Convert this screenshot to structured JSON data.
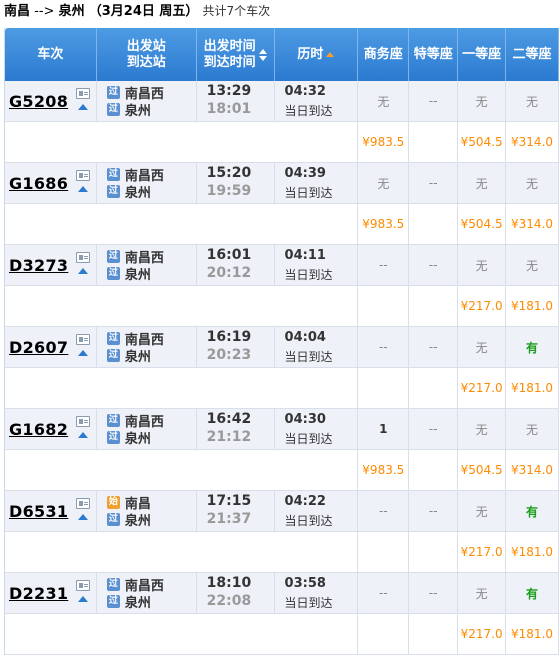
{
  "route": {
    "from": "南昌",
    "arrow": "-->",
    "to": "泉州",
    "date": "（3月24日  周五）",
    "count": "共计7个车次"
  },
  "headers": {
    "train_no": "车次",
    "station_top": "出发站",
    "station_bottom": "到达站",
    "time_top": "出发时间",
    "time_bottom": "到达时间",
    "duration": "历时",
    "business": "商务座",
    "special": "特等座",
    "first": "一等座",
    "second": "二等座"
  },
  "trains": [
    {
      "no": "G5208",
      "from": "南昌西",
      "from_type": "过",
      "to": "泉州",
      "to_type": "过",
      "dep": "13:29",
      "arr": "18:01",
      "dur": "04:32",
      "note": "当日到达",
      "seats": [
        "无",
        "--",
        "无",
        "无"
      ],
      "prices": [
        "¥983.5",
        "",
        "¥504.5",
        "¥314.0"
      ]
    },
    {
      "no": "G1686",
      "from": "南昌西",
      "from_type": "过",
      "to": "泉州",
      "to_type": "过",
      "dep": "15:20",
      "arr": "19:59",
      "dur": "04:39",
      "note": "当日到达",
      "seats": [
        "无",
        "--",
        "无",
        "无"
      ],
      "prices": [
        "¥983.5",
        "",
        "¥504.5",
        "¥314.0"
      ]
    },
    {
      "no": "D3273",
      "from": "南昌西",
      "from_type": "过",
      "to": "泉州",
      "to_type": "过",
      "dep": "16:01",
      "arr": "20:12",
      "dur": "04:11",
      "note": "当日到达",
      "seats": [
        "--",
        "--",
        "无",
        "无"
      ],
      "prices": [
        "",
        "",
        "¥217.0",
        "¥181.0"
      ]
    },
    {
      "no": "D2607",
      "from": "南昌西",
      "from_type": "过",
      "to": "泉州",
      "to_type": "过",
      "dep": "16:19",
      "arr": "20:23",
      "dur": "04:04",
      "note": "当日到达",
      "seats": [
        "--",
        "--",
        "无",
        "有"
      ],
      "prices": [
        "",
        "",
        "¥217.0",
        "¥181.0"
      ]
    },
    {
      "no": "G1682",
      "from": "南昌西",
      "from_type": "过",
      "to": "泉州",
      "to_type": "过",
      "dep": "16:42",
      "arr": "21:12",
      "dur": "04:30",
      "note": "当日到达",
      "seats": [
        "1",
        "--",
        "无",
        "无"
      ],
      "prices": [
        "¥983.5",
        "",
        "¥504.5",
        "¥314.0"
      ]
    },
    {
      "no": "D6531",
      "from": "南昌",
      "from_type": "始",
      "to": "泉州",
      "to_type": "过",
      "dep": "17:15",
      "arr": "21:37",
      "dur": "04:22",
      "note": "当日到达",
      "seats": [
        "--",
        "--",
        "无",
        "有"
      ],
      "prices": [
        "",
        "",
        "¥217.0",
        "¥181.0"
      ]
    },
    {
      "no": "D2231",
      "from": "南昌西",
      "from_type": "过",
      "to": "泉州",
      "to_type": "过",
      "dep": "18:10",
      "arr": "22:08",
      "dur": "03:58",
      "note": "当日到达",
      "seats": [
        "--",
        "--",
        "无",
        "有"
      ],
      "prices": [
        "",
        "",
        "¥217.0",
        "¥181.0"
      ]
    }
  ],
  "colors": {
    "header_bg": "#2c7ad0",
    "price": "#ff8a00",
    "available": "#1a9e1a",
    "row_bg": "#eef1f8"
  },
  "icons": {
    "card": "id-card-icon",
    "expand": "triangle-up-icon",
    "start_badge": "始",
    "pass_badge": "过"
  }
}
